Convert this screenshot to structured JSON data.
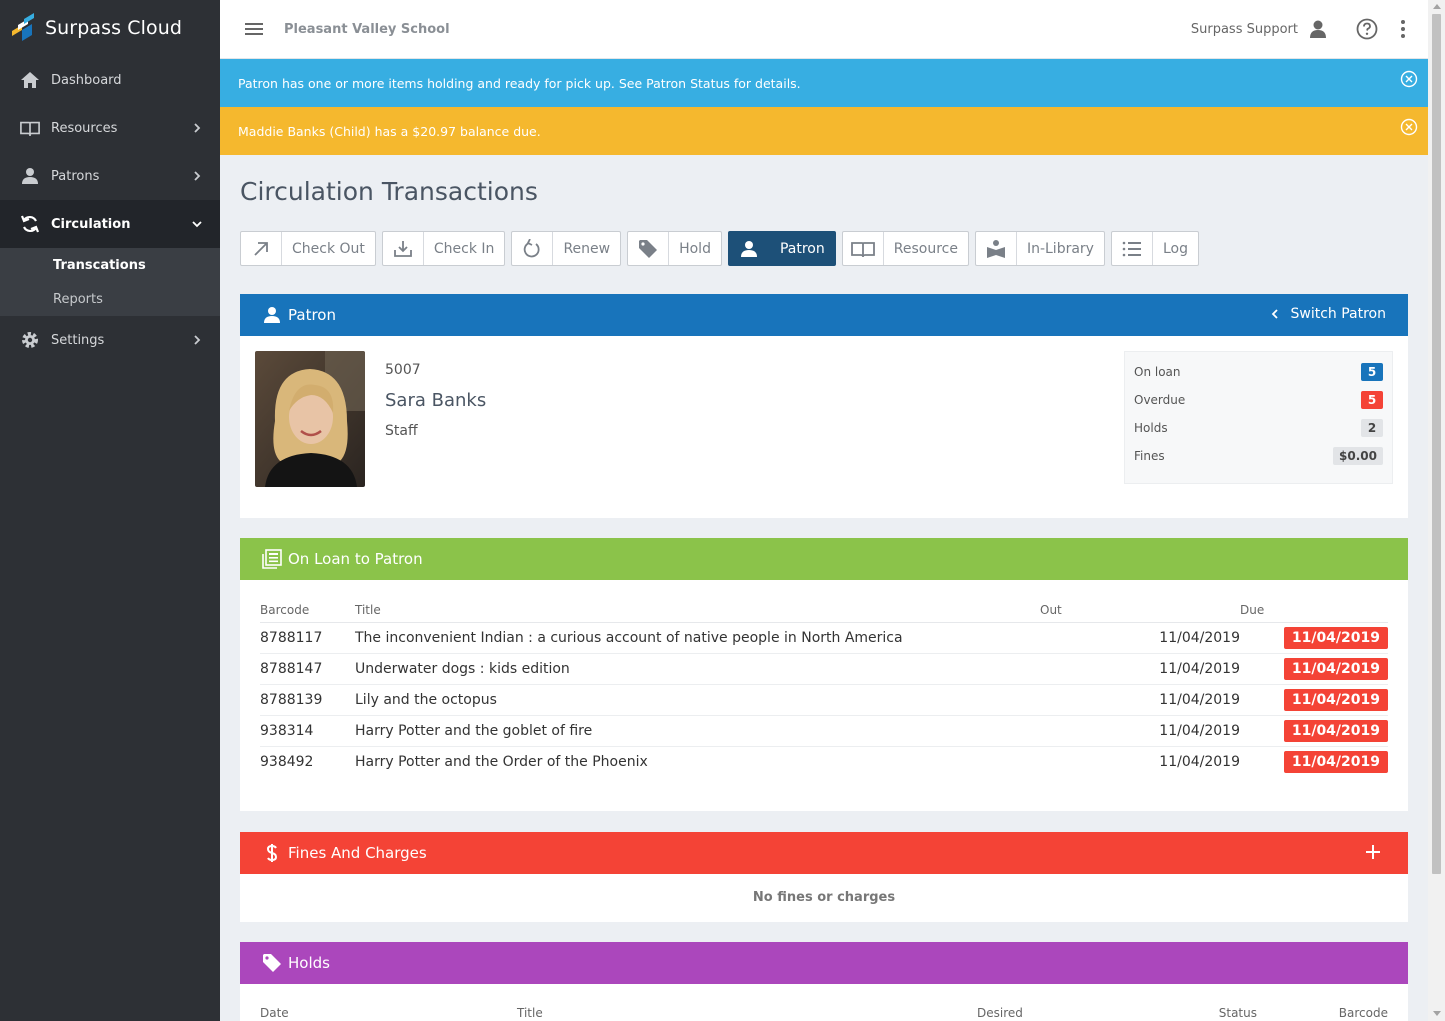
{
  "brand": {
    "name": "Surpass Cloud"
  },
  "sidebar": {
    "items": [
      {
        "label": "Dashboard"
      },
      {
        "label": "Resources"
      },
      {
        "label": "Patrons"
      },
      {
        "label": "Circulation"
      },
      {
        "label": "Settings"
      }
    ],
    "sub_items": [
      {
        "label": "Transcations"
      },
      {
        "label": "Reports"
      }
    ]
  },
  "topbar": {
    "school": "Pleasant Valley School",
    "user": "Surpass Support"
  },
  "alerts": {
    "info": "Patron has one or more items holding and ready for pick up. See Patron Status for details.",
    "warning": "Maddie Banks (Child) has a $20.97 balance due."
  },
  "page": {
    "title": "Circulation Transactions"
  },
  "toolbar": {
    "buttons": [
      {
        "label": "Check Out"
      },
      {
        "label": "Check In"
      },
      {
        "label": "Renew"
      },
      {
        "label": "Hold"
      },
      {
        "label": "Patron"
      },
      {
        "label": "Resource"
      },
      {
        "label": "In-Library"
      },
      {
        "label": "Log"
      }
    ]
  },
  "patron_panel": {
    "title": "Patron",
    "switch_label": "Switch Patron",
    "id": "5007",
    "name": "Sara Banks",
    "type": "Staff",
    "stats": [
      {
        "label": "On loan",
        "value": "5"
      },
      {
        "label": "Overdue",
        "value": "5"
      },
      {
        "label": "Holds",
        "value": "2"
      },
      {
        "label": "Fines",
        "value": "$0.00"
      }
    ]
  },
  "loans_panel": {
    "title": "On Loan to Patron",
    "columns": {
      "barcode": "Barcode",
      "title": "Title",
      "out": "Out",
      "due": "Due"
    },
    "rows": [
      {
        "barcode": "8788117",
        "title": "The inconvenient Indian : a curious account of native people in North America",
        "out": "11/04/2019",
        "due": "11/04/2019"
      },
      {
        "barcode": "8788147",
        "title": "Underwater dogs : kids edition",
        "out": "11/04/2019",
        "due": "11/04/2019"
      },
      {
        "barcode": "8788139",
        "title": "Lily and the octopus",
        "out": "11/04/2019",
        "due": "11/04/2019"
      },
      {
        "barcode": "938314",
        "title": "Harry Potter and the goblet of fire",
        "out": "11/04/2019",
        "due": "11/04/2019"
      },
      {
        "barcode": "938492",
        "title": "Harry Potter and the Order of the Phoenix",
        "out": "11/04/2019",
        "due": "11/04/2019"
      }
    ]
  },
  "fines_panel": {
    "title": "Fines And Charges",
    "empty_text": "No fines or charges"
  },
  "holds_panel": {
    "title": "Holds",
    "columns": {
      "date": "Date",
      "title": "Title",
      "desired": "Desired",
      "status": "Status",
      "barcode": "Barcode"
    }
  },
  "colors": {
    "sidebar": "#2d3035",
    "info": "#37aee2",
    "warning": "#f5b82e",
    "patron_header": "#1874bb",
    "loans_header": "#8bc34a",
    "fines_header": "#f44336",
    "holds_header": "#ab47bc",
    "active_button": "#1d5078"
  }
}
